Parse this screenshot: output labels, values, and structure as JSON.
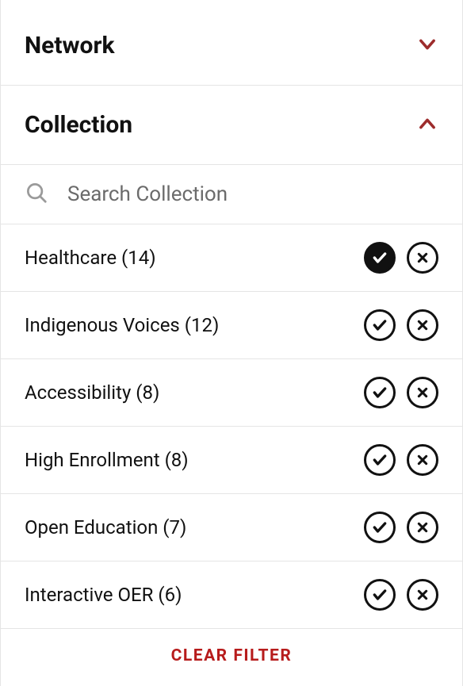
{
  "sections": {
    "network": {
      "title": "Network",
      "expanded": false
    },
    "collection": {
      "title": "Collection",
      "expanded": true,
      "search_placeholder": "Search Collection",
      "items": [
        {
          "label": "Healthcare (14)",
          "selected": true
        },
        {
          "label": "Indigenous Voices (12)",
          "selected": false
        },
        {
          "label": "Accessibility (8)",
          "selected": false
        },
        {
          "label": "High Enrollment (8)",
          "selected": false
        },
        {
          "label": "Open Education (7)",
          "selected": false
        },
        {
          "label": "Interactive OER (6)",
          "selected": false
        }
      ],
      "clear_label": "CLEAR FILTER"
    }
  },
  "colors": {
    "accent": "#9d2c2c"
  }
}
